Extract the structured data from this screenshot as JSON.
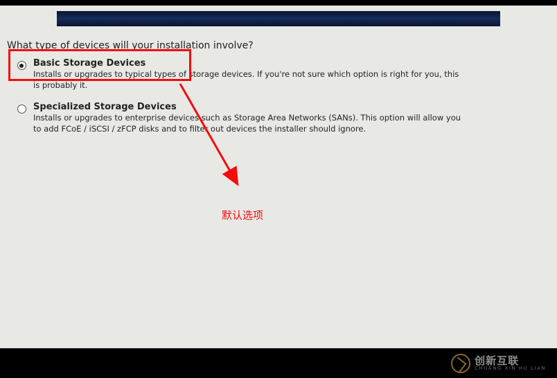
{
  "question": "What type of devices will your installation involve?",
  "options": [
    {
      "title": "Basic Storage Devices",
      "desc": "Installs or upgrades to typical types of storage devices.  If you're not sure which option is right for you, this is probably it.",
      "selected": true
    },
    {
      "title": "Specialized Storage Devices",
      "desc": "Installs or upgrades to enterprise devices such as Storage Area Networks (SANs). This option will allow you to add FCoE / iSCSI / zFCP disks and to filter out devices the installer should ignore.",
      "selected": false
    }
  ],
  "annotation_label": "默认选项",
  "watermark": {
    "main": "创新互联",
    "sub": "CHUANG XIN HU LIAN"
  }
}
